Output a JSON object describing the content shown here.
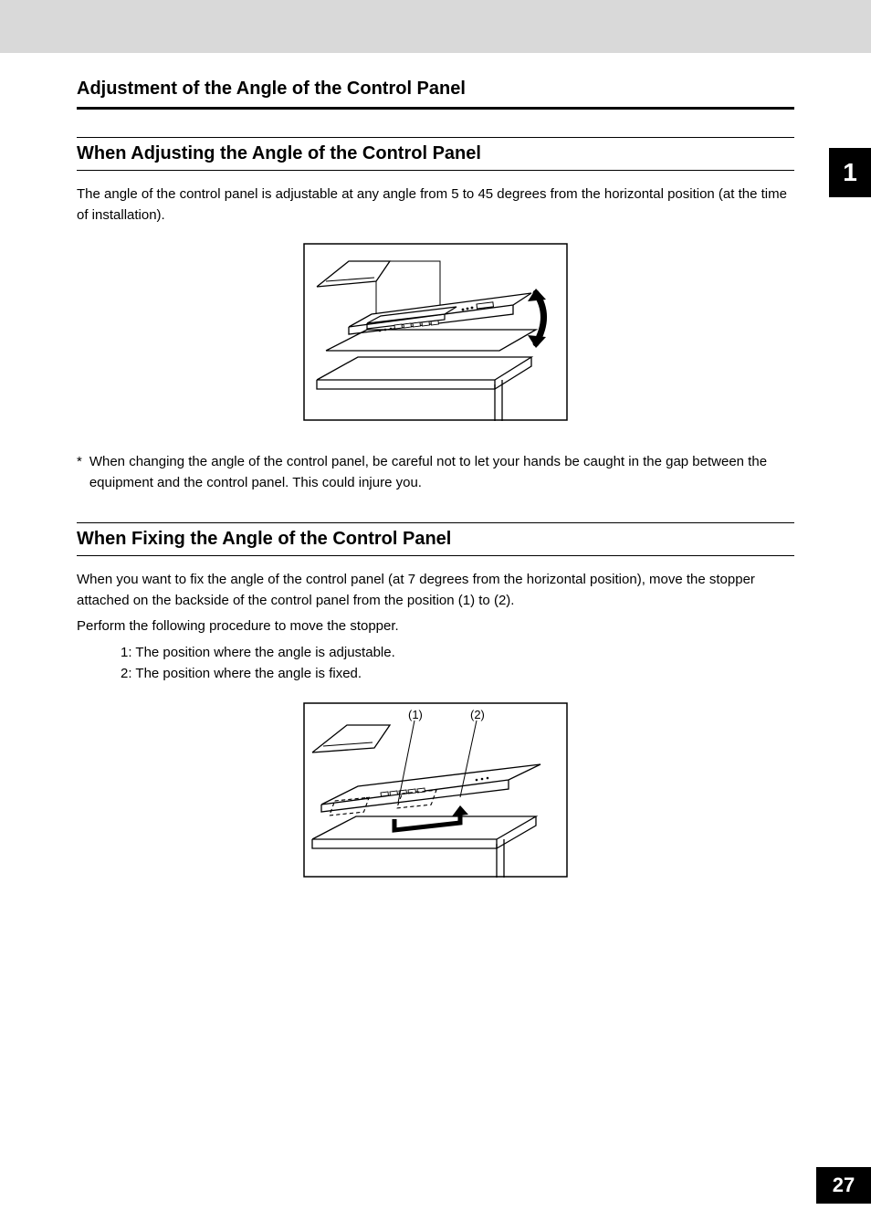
{
  "chapter_number": "1",
  "page_number": "27",
  "main_heading": "Adjustment of the Angle of the Control Panel",
  "section1": {
    "heading": "When Adjusting the Angle of the Control Panel",
    "body": "The angle of the control panel is adjustable at any angle from 5 to 45 degrees from the horizontal position (at the time of installation).",
    "caution_marker": "*",
    "caution_text": "When changing the angle of the control panel, be careful not to let your hands be caught in the gap between the equipment and the control panel. This could injure you."
  },
  "section2": {
    "heading": "When Fixing the Angle of the Control Panel",
    "body_p1": "When you want to fix the angle of the control panel (at 7 degrees from the horizontal position), move the stopper attached on the backside of the control panel from the position (1) to (2).",
    "body_p2": "Perform the following procedure to move the stopper.",
    "list_item1": "1: The position where the angle is adjustable.",
    "list_item2": "2: The position where the angle is fixed.",
    "callout1": "(1)",
    "callout2": "(2)"
  }
}
